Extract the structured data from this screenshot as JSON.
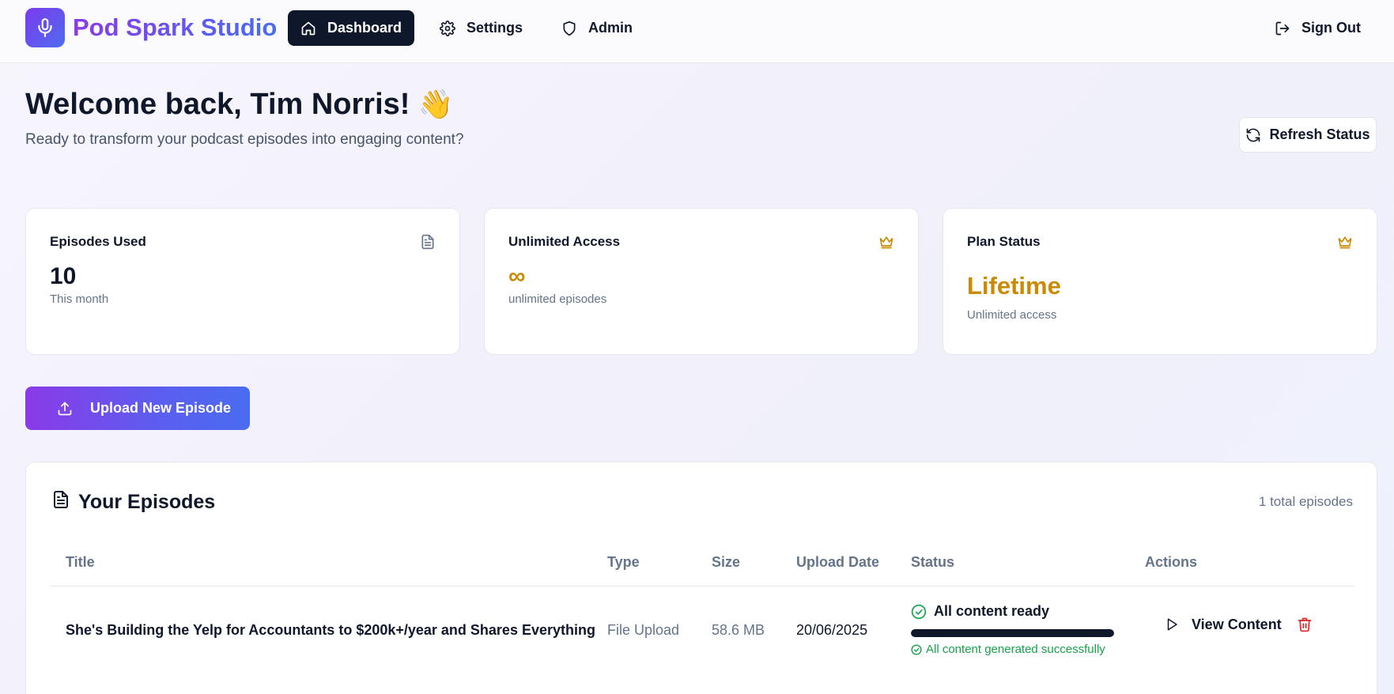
{
  "app": {
    "name": "Pod Spark Studio"
  },
  "nav": {
    "dashboard": "Dashboard",
    "settings": "Settings",
    "admin": "Admin",
    "sign_out": "Sign Out"
  },
  "welcome": {
    "title": "Welcome back, Tim Norris!",
    "emoji": "👋",
    "subtitle": "Ready to transform your podcast episodes into engaging content?",
    "refresh_label": "Refresh Status"
  },
  "stats": [
    {
      "title": "Episodes Used",
      "value": "10",
      "sub": "This month",
      "icon": "document-icon"
    },
    {
      "title": "Unlimited Access",
      "value": "∞",
      "sub": "unlimited episodes",
      "icon": "crown-icon"
    },
    {
      "title": "Plan Status",
      "value": "Lifetime",
      "sub": "Unlimited access",
      "icon": "crown-icon"
    }
  ],
  "upload": {
    "label": "Upload New Episode"
  },
  "episodes": {
    "title": "Your Episodes",
    "count_text": "1 total episodes",
    "columns": [
      "Title",
      "Type",
      "Size",
      "Upload Date",
      "Status",
      "Actions"
    ],
    "rows": [
      {
        "title": "She's Building the Yelp for Accountants to $200k+/year and Shares Everything",
        "type": "File Upload",
        "size": "58.6 MB",
        "upload_date": "20/06/2025",
        "status": "All content ready",
        "progress": 1.0,
        "status_detail": "All content generated successfully",
        "view_label": "View Content"
      }
    ]
  },
  "colors": {
    "brand_purple": "#8b3ae8",
    "brand_blue": "#4a6cf0",
    "gold": "#ca8a04",
    "success": "#16a34a",
    "danger": "#dc2626",
    "dark": "#0f172a"
  }
}
